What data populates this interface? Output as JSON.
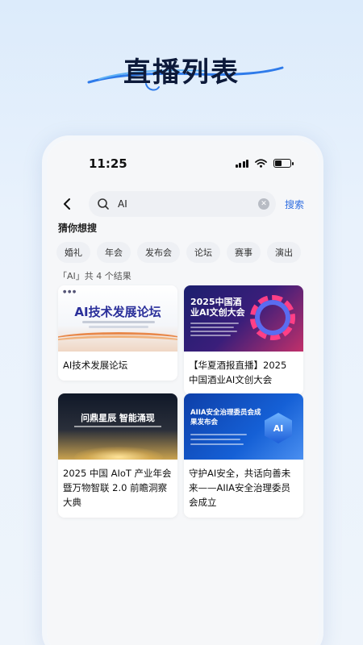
{
  "hero": {
    "title": "直播列表"
  },
  "status_bar": {
    "time": "11:25"
  },
  "search": {
    "query": "AI",
    "search_label": "搜索"
  },
  "guess": {
    "title": "猜你想搜",
    "tags": [
      "婚礼",
      "年会",
      "发布会",
      "论坛",
      "赛事",
      "演出"
    ]
  },
  "results": {
    "count_text": "「AI」共 4 个结果",
    "items": [
      {
        "title": "AI技术发展论坛",
        "thumb_text": "AI技术发展论坛"
      },
      {
        "title": "【华夏酒报直播】2025 中国酒业AI文创大会",
        "thumb_text": "2025中国酒业AI文创大会"
      },
      {
        "title": "2025 中国 AIoT 产业年会暨万物智联 2.0 前瞻洞察大典",
        "thumb_text": "问鼎星辰 智能涌现"
      },
      {
        "title": "守护AI安全，共话向善未来——AIIA安全治理委员会成立",
        "thumb_text": "AIIA安全治理委员会成果发布会",
        "badge": "AI"
      }
    ]
  },
  "colors": {
    "accent": "#2f6de0",
    "hero_text": "#0d1a3a"
  }
}
